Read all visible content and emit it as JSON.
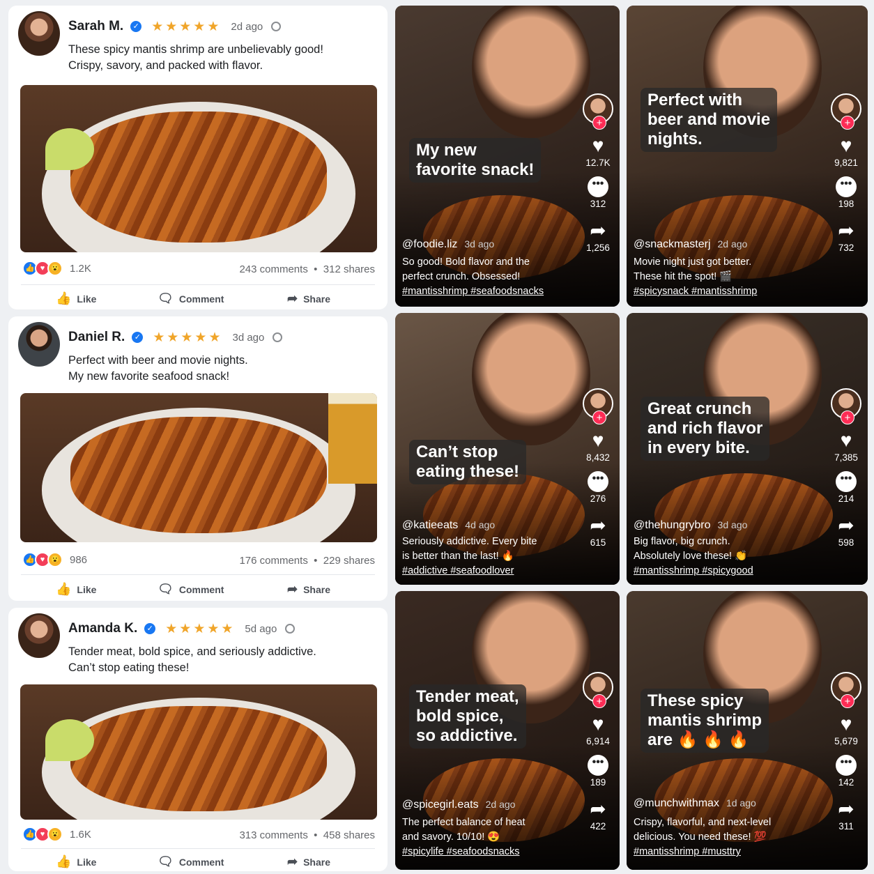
{
  "posts": [
    {
      "name": "Sarah M.",
      "stars": "★★★★★",
      "time": "2d ago",
      "text1": "These spicy mantis shrimp are unbelievably good!",
      "text2": "Crispy, savory, and packed with flavor.",
      "reactions": "1.2K",
      "comments": "243 comments",
      "shares": "312 shares"
    },
    {
      "name": "Daniel R.",
      "stars": "★★★★★",
      "time": "3d ago",
      "text1": "Perfect with beer and movie nights.",
      "text2": "My new favorite seafood snack!",
      "reactions": "986",
      "comments": "176 comments",
      "shares": "229 shares"
    },
    {
      "name": "Amanda K.",
      "stars": "★★★★★",
      "time": "5d ago",
      "text1": "Tender meat, bold spice, and seriously addictive.",
      "text2": "Can’t stop eating these!",
      "reactions": "1.6K",
      "comments": "313 comments",
      "shares": "458 shares"
    }
  ],
  "actions": {
    "like": "Like",
    "comment": "Comment",
    "share": "Share",
    "dot": "•"
  },
  "icons": {
    "verified": "verified-check-icon",
    "globe": "globe-icon",
    "like": "thumbs-up-icon",
    "comment": "speech-bubble-icon",
    "share": "share-arrow-icon",
    "heart": "heart-icon",
    "plus": "plus-icon"
  },
  "videos": [
    {
      "caption1": "My new",
      "caption2": "favorite snack!",
      "caption3": "",
      "likes": "12.7K",
      "comments": "312",
      "shares": "1,256",
      "user": "@foodie.liz",
      "time": "3d ago",
      "desc1": "So good! Bold flavor and the",
      "desc2": "perfect crunch. Obsessed!",
      "tags": "#mantisshrimp #seafoodsnacks"
    },
    {
      "caption1": "Perfect with",
      "caption2": "beer and movie",
      "caption3": "nights.",
      "likes": "9,821",
      "comments": "198",
      "shares": "732",
      "user": "@snackmasterj",
      "time": "2d ago",
      "desc1": "Movie night just got better.",
      "desc2": "These hit the spot! 🎬",
      "tags": "#spicysnack #mantisshrimp"
    },
    {
      "caption1": "Can’t stop",
      "caption2": "eating these!",
      "caption3": "",
      "likes": "8,432",
      "comments": "276",
      "shares": "615",
      "user": "@katieeats",
      "time": "4d ago",
      "desc1": "Seriously addictive. Every bite",
      "desc2": "is better than the last! 🔥",
      "tags": "#addictive #seafoodlover"
    },
    {
      "caption1": "Great crunch",
      "caption2": "and rich flavor",
      "caption3": "in every bite.",
      "likes": "7,385",
      "comments": "214",
      "shares": "598",
      "user": "@thehungrybro",
      "time": "3d ago",
      "desc1": "Big flavor, big crunch.",
      "desc2": "Absolutely love these! 👏",
      "tags": "#mantisshrimp #spicygood"
    },
    {
      "caption1": "Tender meat,",
      "caption2": "bold spice,",
      "caption3": "so addictive.",
      "likes": "6,914",
      "comments": "189",
      "shares": "422",
      "user": "@spicegirl.eats",
      "time": "2d ago",
      "desc1": "The perfect balance of heat",
      "desc2": "and savory. 10/10! 😍",
      "tags": "#spicylife #seafoodsnacks"
    },
    {
      "caption1": "These spicy",
      "caption2": "mantis shrimp",
      "caption3": "are 🔥 🔥 🔥",
      "likes": "5,679",
      "comments": "142",
      "shares": "311",
      "user": "@munchwithmax",
      "time": "1d ago",
      "desc1": "Crispy, flavorful, and next-level",
      "desc2": "delicious. You need these! 💯",
      "tags": "#mantisshrimp #musttry"
    }
  ]
}
